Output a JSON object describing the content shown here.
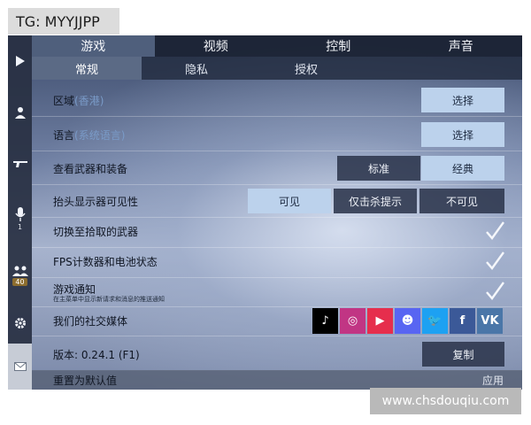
{
  "overlay": {
    "tg_label": "TG: MYYJJPP",
    "watermark": "www.chsdouqiu.com"
  },
  "rail": {
    "items": [
      {
        "icon": "play-icon",
        "count": ""
      },
      {
        "icon": "person-icon",
        "count": ""
      },
      {
        "icon": "gun-icon",
        "count": ""
      },
      {
        "icon": "microphone-icon",
        "count": "1"
      },
      {
        "icon": "group-icon",
        "count": "40"
      },
      {
        "icon": "gear-icon",
        "count": ""
      },
      {
        "icon": "mail-icon",
        "count": ""
      }
    ]
  },
  "top_tabs": [
    "游戏",
    "视频",
    "控制",
    "声音"
  ],
  "sub_tabs": [
    "常规",
    "隐私",
    "授权"
  ],
  "rows": {
    "region": {
      "label": "区域",
      "sub": "(香港)",
      "button": "选择"
    },
    "language": {
      "label": "语言",
      "sub": "(系统语言)",
      "button": "选择"
    },
    "weapons": {
      "label": "查看武器和装备",
      "options": [
        "标准",
        "经典"
      ],
      "selected": "经典"
    },
    "hud": {
      "label": "抬头显示器可见性",
      "options": [
        "可见",
        "仅击杀提示",
        "不可见"
      ],
      "selected": "可见"
    },
    "switch_weapon": {
      "label": "切换至拾取的武器",
      "checked": true
    },
    "fps": {
      "label": "FPS计数器和电池状态",
      "checked": true
    },
    "notify": {
      "label": "游戏通知",
      "note": "在主菜单中显示新请求和消息的推送通知",
      "checked": true
    },
    "social": {
      "label": "我们的社交媒体",
      "icons": [
        {
          "name": "tiktok-icon",
          "glyph": "♪",
          "color": "#000000"
        },
        {
          "name": "instagram-icon",
          "glyph": "◎",
          "color": "#c13584"
        },
        {
          "name": "youtube-icon",
          "glyph": "▶",
          "color": "#e62e4d"
        },
        {
          "name": "discord-icon",
          "glyph": "☻",
          "color": "#5865f2"
        },
        {
          "name": "twitter-icon",
          "glyph": "🐦",
          "color": "#1da1f2"
        },
        {
          "name": "facebook-icon",
          "glyph": "f",
          "color": "#3b5998"
        },
        {
          "name": "vk-icon",
          "glyph": "VK",
          "color": "#4a76a8"
        }
      ]
    },
    "version": {
      "label": "版本: 0.24.1 (F1)",
      "button": "复制"
    }
  },
  "bottom": {
    "label": "重置为默认值",
    "apply": "应用"
  },
  "colors": {
    "selected": "#bcd2ec",
    "dark_button": "#2c364c",
    "tab_bar": "#1a2232"
  }
}
